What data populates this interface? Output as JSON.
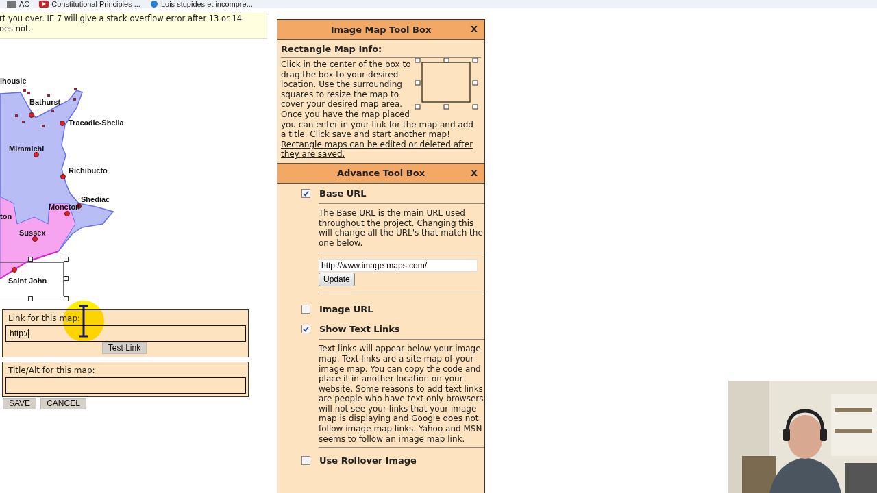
{
  "bookmarks_bar": {
    "items": [
      {
        "label": "AC",
        "kind": "folder"
      },
      {
        "label": "Constitutional Principles ...",
        "kind": "video"
      },
      {
        "label": "Lois stupides et incompre...",
        "kind": "web"
      }
    ]
  },
  "notice": {
    "lines": [
      "rt you over. IE 7 will give a stack overflow error after 13 or 14",
      "oes not."
    ]
  },
  "map": {
    "cities": [
      {
        "name": "lhousie"
      },
      {
        "name": "Bathurst"
      },
      {
        "name": "Tracadie-Sheila"
      },
      {
        "name": "Miramichi"
      },
      {
        "name": "Richibucto"
      },
      {
        "name": "Shediac"
      },
      {
        "name": "Moncton"
      },
      {
        "name": "ton"
      },
      {
        "name": "Sussex"
      },
      {
        "name": "Saint John"
      }
    ]
  },
  "link_form": {
    "label": "Link for this map:",
    "value": "http:/",
    "button": "Test Link"
  },
  "title_form": {
    "label": "Title/Alt for this map:"
  },
  "actions": [
    "SAVE",
    "CANCEL"
  ],
  "image_map_tool_box": {
    "title": "Image Map Tool Box",
    "close": "X",
    "heading": "Rectangle Map Info:",
    "text": "Click in the center of the box to drag the box to your desired location. Use the surrounding squares to resize the map to cover your desired map area. Once you have the map placed you can enter in your link for the map and add a title. Click save and start another map!",
    "link": "Rectangle maps can be edited or deleted after they are saved."
  },
  "advance_tool_box": {
    "title": "Advance Tool Box",
    "close": "X",
    "options": [
      {
        "kind": "url",
        "label": "Base URL",
        "checked": true,
        "description": "The Base URL is the main URL used throughout the project. Changing this will change all the URL's that match the one below.",
        "url_value": "http://www.image-maps.com/",
        "button": "Update"
      },
      {
        "kind": "plain",
        "label": "Image URL",
        "checked": false
      },
      {
        "kind": "text",
        "label": "Show Text Links",
        "checked": true,
        "description": "Text links will appear below your image map. Text links are a site map of your image map. You can copy the code and place it in another location on your website. Some reasons to add text links are people who have text only browsers will not see your links that your image map is displaying and Google does not follow image map links. Yahoo and MSN seems to follow an image map link."
      },
      {
        "kind": "plain",
        "label": "Use Rollover Image",
        "checked": false
      }
    ]
  },
  "webcam": {
    "kind": "picture"
  }
}
